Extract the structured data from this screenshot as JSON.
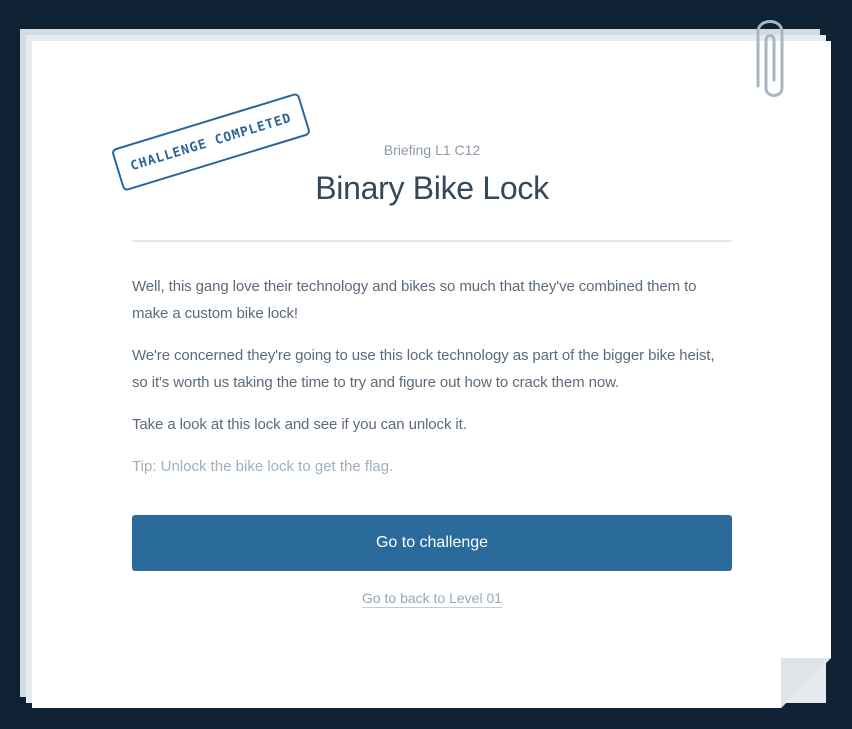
{
  "briefing": {
    "subtitle": "Briefing L1 C12",
    "title": "Binary Bike Lock",
    "stamp": "CHALLENGE COMPLETED",
    "paragraphs": [
      "Well, this gang love their technology and bikes so much that they've combined them to make a custom bike lock!",
      "We're concerned they're going to use this lock technology as part of the bigger bike heist, so it's worth us taking the time to try and figure out how to crack them now.",
      "Take a look at this lock and see if you can unlock it."
    ],
    "tip": "Tip: Unlock the bike lock to get the flag.",
    "cta_label": "Go to challenge",
    "back_label": "Go to back to Level 01"
  },
  "icons": {
    "paperclip": "paperclip-icon"
  },
  "colors": {
    "background": "#0f2233",
    "accent": "#2a6b9c",
    "stamp": "#2a6698"
  }
}
